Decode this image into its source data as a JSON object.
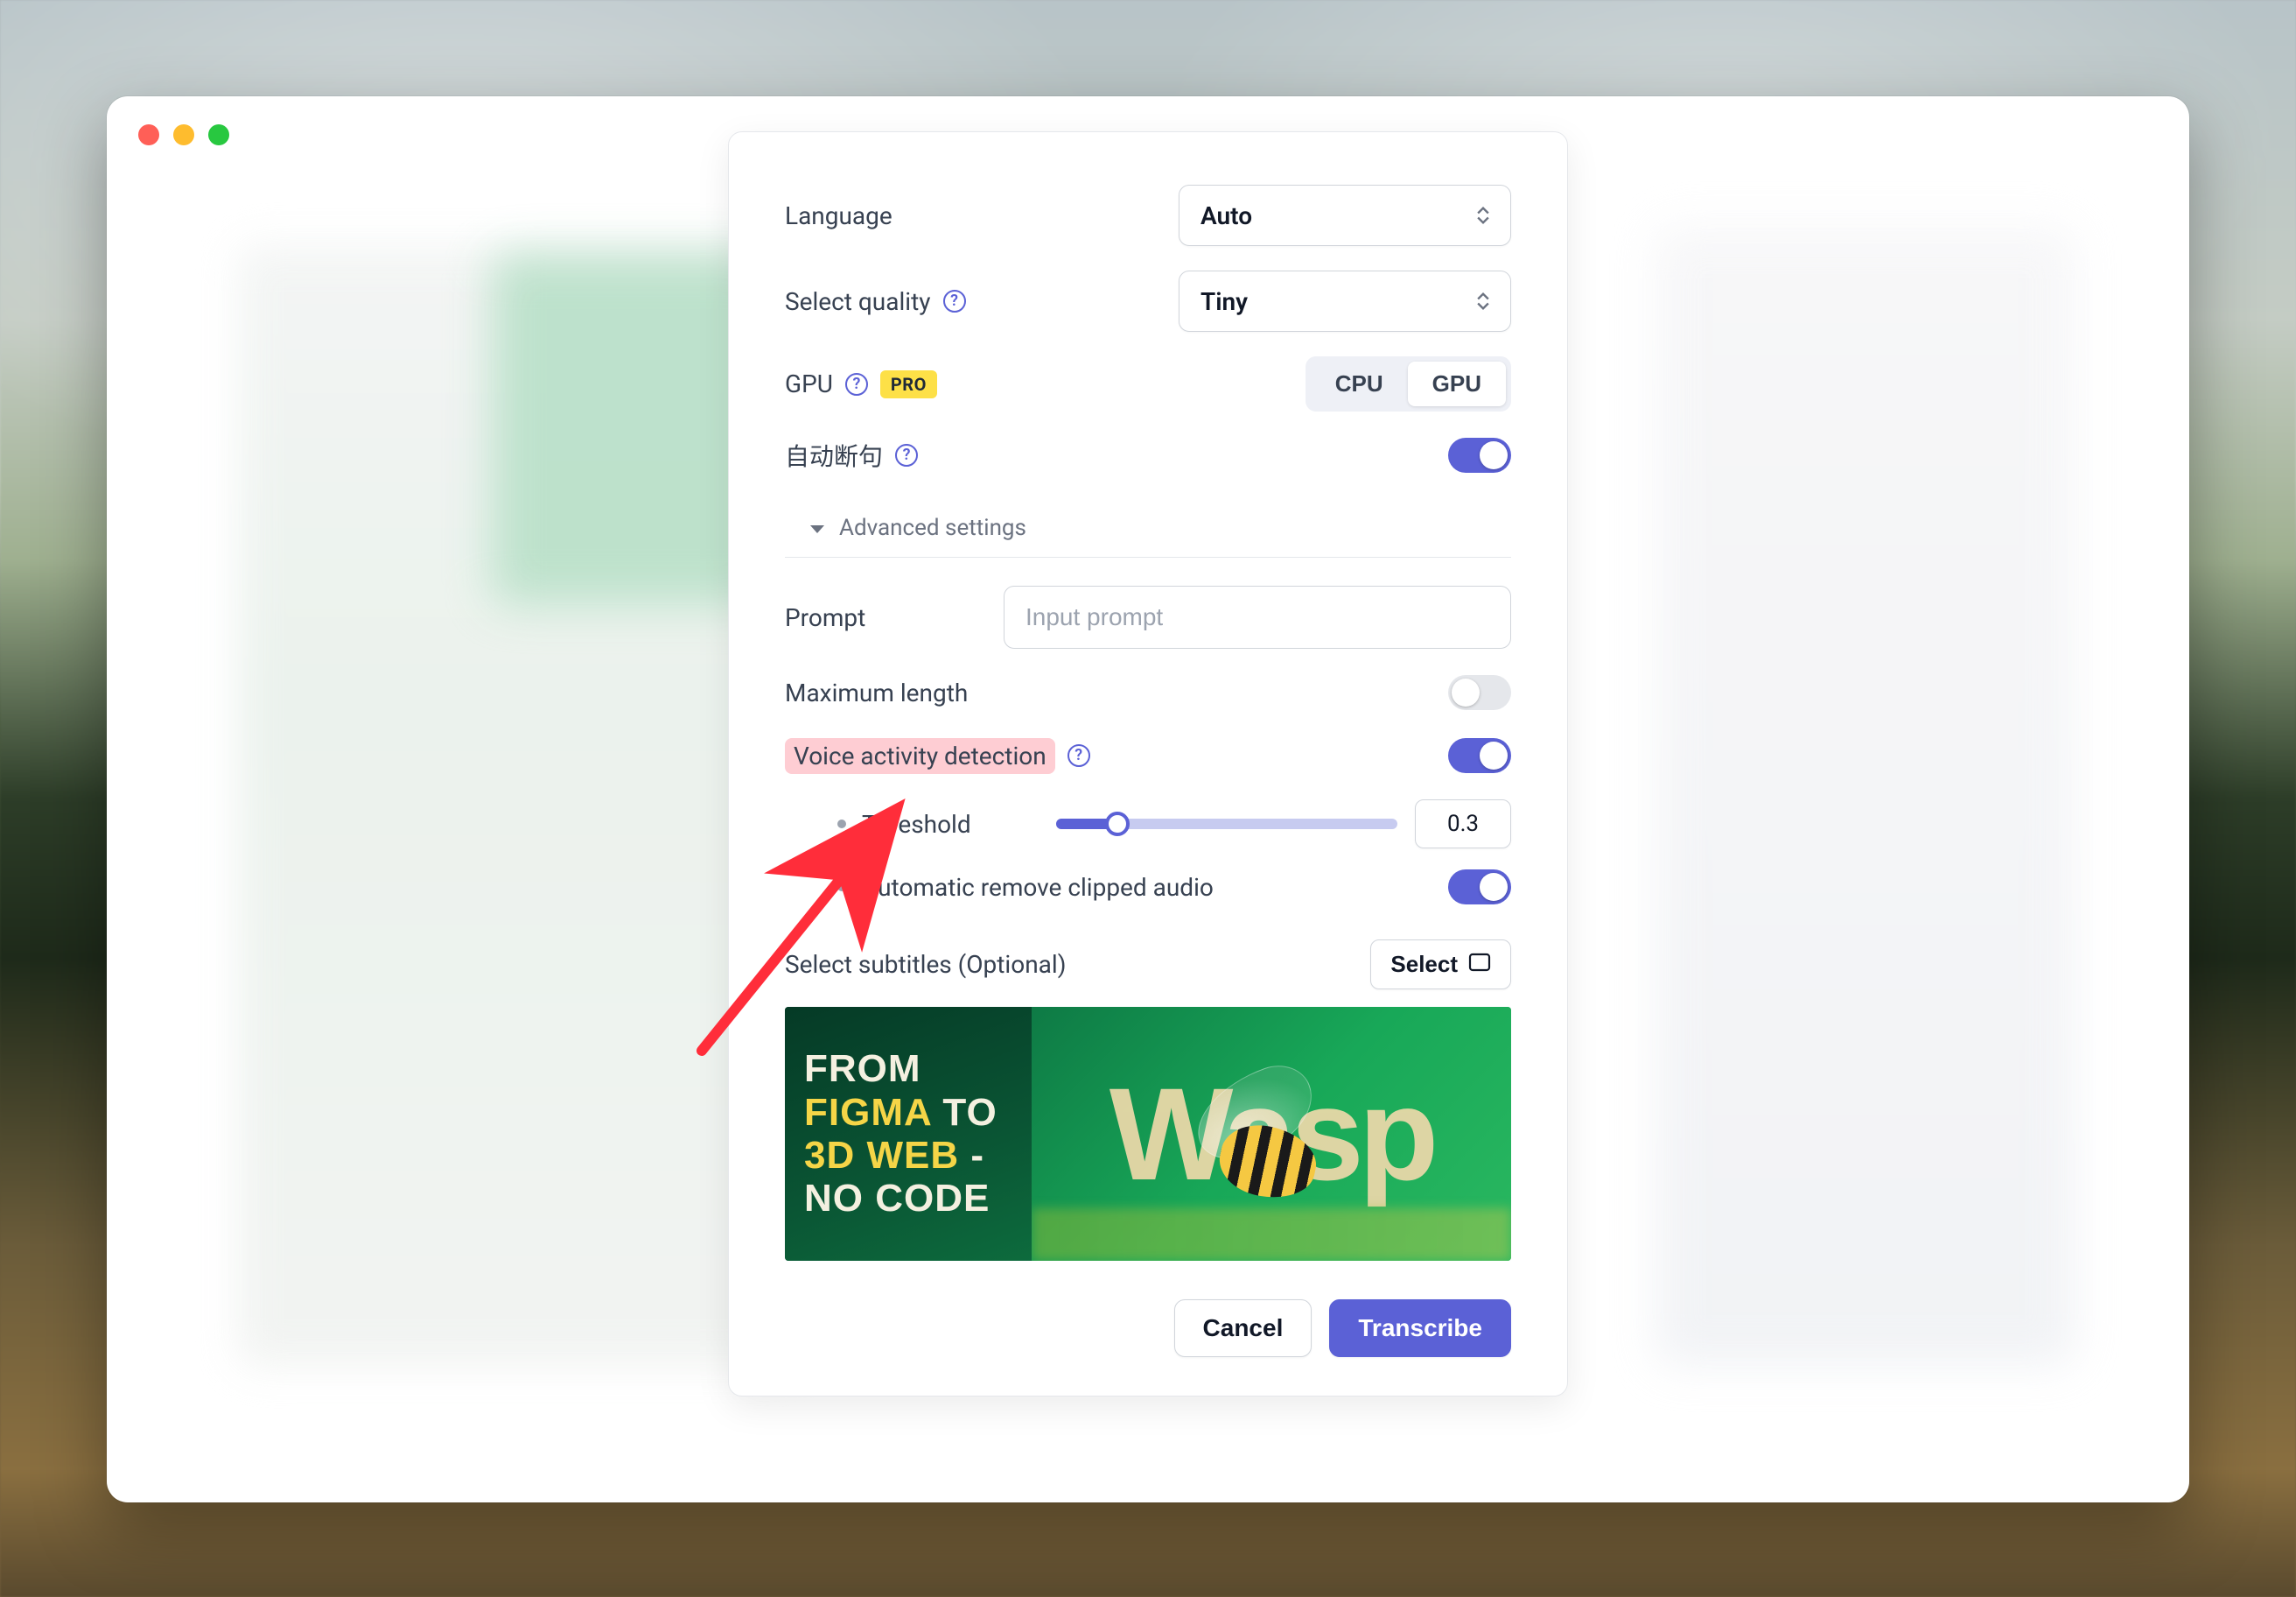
{
  "labels": {
    "language": "Language",
    "select_quality": "Select quality",
    "gpu": "GPU",
    "auto_break": "自动断句",
    "advanced_settings": "Advanced settings",
    "prompt": "Prompt",
    "max_length": "Maximum length",
    "vad": "Voice activity detection",
    "threshold": "Threshold",
    "auto_remove_clipped": "Automatic remove clipped audio",
    "select_subtitles": "Select subtitles (Optional)"
  },
  "values": {
    "language_selected": "Auto",
    "quality_selected": "Tiny",
    "prompt_placeholder": "Input prompt",
    "threshold_value": "0.3"
  },
  "badges": {
    "pro": "PRO"
  },
  "segmented": {
    "cpu": "CPU",
    "gpu": "GPU",
    "active": "GPU"
  },
  "toggles": {
    "auto_break": true,
    "max_length": false,
    "vad": true,
    "auto_remove_clipped": true
  },
  "buttons": {
    "select": "Select",
    "cancel": "Cancel",
    "transcribe": "Transcribe"
  },
  "preview": {
    "left_lines": [
      "FROM",
      "FIGMA",
      "TO",
      "3D WEB",
      "-",
      "NO CODE"
    ],
    "right_word": "Wasp"
  }
}
